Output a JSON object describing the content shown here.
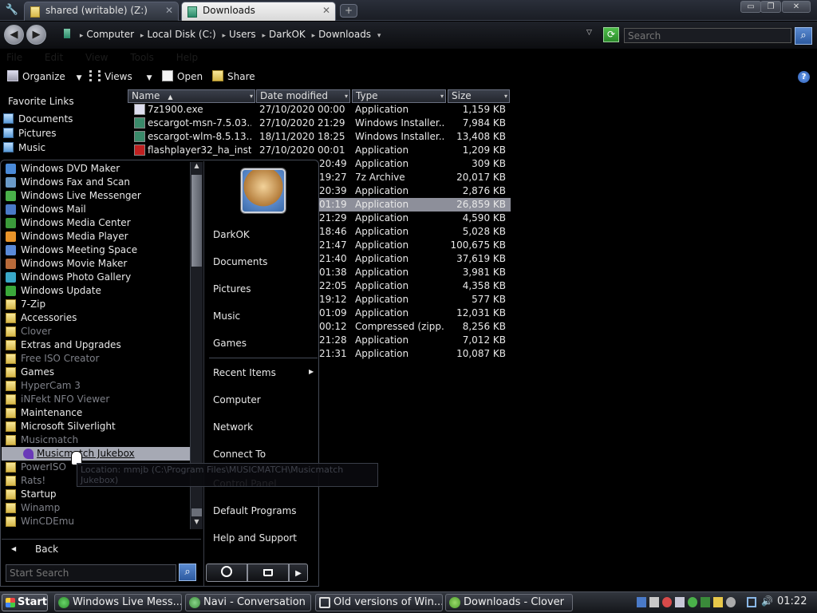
{
  "tabs": [
    {
      "label": "shared (writable) (Z:)"
    },
    {
      "label": "Downloads"
    }
  ],
  "window_controls": {
    "minimize": "▭",
    "restore": "❐",
    "close": "✕"
  },
  "address": {
    "crumbs": [
      "Computer",
      "Local Disk (C:)",
      "Users",
      "DarkOK",
      "Downloads"
    ],
    "search_placeholder": "Search"
  },
  "menubar": [
    "File",
    "Edit",
    "View",
    "Tools",
    "Help"
  ],
  "toolbar": {
    "organize": "Organize",
    "views": "Views",
    "open": "Open",
    "share": "Share",
    "help": "?"
  },
  "favorites": {
    "title": "Favorite Links",
    "items": [
      "Documents",
      "Pictures",
      "Music"
    ]
  },
  "columns": {
    "name": "Name",
    "date": "Date modified",
    "type": "Type",
    "size": "Size"
  },
  "files": [
    {
      "name": "7z1900.exe",
      "date": "27/10/2020 00:00",
      "type": "Application",
      "size": "1,159 KB"
    },
    {
      "name": "escargot-msn-7.5.03...",
      "date": "27/10/2020 21:29",
      "type": "Windows Installer...",
      "size": "7,984 KB"
    },
    {
      "name": "escargot-wlm-8.5.13...",
      "date": "18/11/2020 18:25",
      "type": "Windows Installer...",
      "size": "13,408 KB"
    },
    {
      "name": "flashplayer32_ha_insta...",
      "date": "27/10/2020 00:01",
      "type": "Application",
      "size": "1,209 KB"
    },
    {
      "name": "",
      "date": "20:49",
      "type": "Application",
      "size": "309 KB"
    },
    {
      "name": "",
      "date": "19:27",
      "type": "7z Archive",
      "size": "20,017 KB"
    },
    {
      "name": "",
      "date": "20:39",
      "type": "Application",
      "size": "2,876 KB"
    },
    {
      "name": "",
      "date": "01:19",
      "type": "Application",
      "size": "26,859 KB"
    },
    {
      "name": "",
      "date": "21:29",
      "type": "Application",
      "size": "4,590 KB"
    },
    {
      "name": "",
      "date": "18:46",
      "type": "Application",
      "size": "5,028 KB"
    },
    {
      "name": "",
      "date": "21:47",
      "type": "Application",
      "size": "100,675 KB"
    },
    {
      "name": "",
      "date": "21:40",
      "type": "Application",
      "size": "37,619 KB"
    },
    {
      "name": "",
      "date": "01:38",
      "type": "Application",
      "size": "3,981 KB"
    },
    {
      "name": "",
      "date": "22:05",
      "type": "Application",
      "size": "4,358 KB"
    },
    {
      "name": "",
      "date": "19:12",
      "type": "Application",
      "size": "577 KB"
    },
    {
      "name": "",
      "date": "01:09",
      "type": "Application",
      "size": "12,031 KB"
    },
    {
      "name": "",
      "date": "00:12",
      "type": "Compressed (zipp...",
      "size": "8,256 KB"
    },
    {
      "name": "",
      "date": "21:28",
      "type": "Application",
      "size": "7,012 KB"
    },
    {
      "name": "",
      "date": "21:31",
      "type": "Application",
      "size": "10,087 KB"
    }
  ],
  "programs": [
    {
      "label": "Windows DVD Maker",
      "kind": "app",
      "color": "#4a8ad8"
    },
    {
      "label": "Windows Fax and Scan",
      "kind": "app",
      "color": "#6a9ac8"
    },
    {
      "label": "Windows Live Messenger",
      "kind": "app",
      "color": "#4ab04a"
    },
    {
      "label": "Windows Mail",
      "kind": "app",
      "color": "#4a7ac8"
    },
    {
      "label": "Windows Media Center",
      "kind": "app",
      "color": "#3a9a3a"
    },
    {
      "label": "Windows Media Player",
      "kind": "app",
      "color": "#e8942a"
    },
    {
      "label": "Windows Meeting Space",
      "kind": "app",
      "color": "#5a8ad8"
    },
    {
      "label": "Windows Movie Maker",
      "kind": "app",
      "color": "#b86a3a"
    },
    {
      "label": "Windows Photo Gallery",
      "kind": "app",
      "color": "#3aa8c8"
    },
    {
      "label": "Windows Update",
      "kind": "app",
      "color": "#3aa83a"
    },
    {
      "label": "7-Zip",
      "kind": "folder"
    },
    {
      "label": "Accessories",
      "kind": "folder"
    },
    {
      "label": "Clover",
      "kind": "folder",
      "dim": true
    },
    {
      "label": "Extras and Upgrades",
      "kind": "folder"
    },
    {
      "label": "Free ISO Creator",
      "kind": "folder",
      "dim": true
    },
    {
      "label": "Games",
      "kind": "folder"
    },
    {
      "label": "HyperCam 3",
      "kind": "folder",
      "dim": true
    },
    {
      "label": "iNFekt NFO Viewer",
      "kind": "folder",
      "dim": true
    },
    {
      "label": "Maintenance",
      "kind": "folder"
    },
    {
      "label": "Microsoft Silverlight",
      "kind": "folder"
    },
    {
      "label": "Musicmatch",
      "kind": "folder",
      "dim": true
    },
    {
      "label": "Musicmatch Jukebox",
      "kind": "sub",
      "highlight": true
    },
    {
      "label": "PowerISO",
      "kind": "folder",
      "dim": true
    },
    {
      "label": "Rats!",
      "kind": "folder",
      "dim": true
    },
    {
      "label": "Startup",
      "kind": "folder"
    },
    {
      "label": "Winamp",
      "kind": "folder",
      "dim": true
    },
    {
      "label": "WinCDEmu",
      "kind": "folder",
      "dim": true
    }
  ],
  "back_label": "Back",
  "start_search_placeholder": "Start Search",
  "right_pane": {
    "user": "DarkOK",
    "items1": [
      "Documents",
      "Pictures",
      "Music",
      "Games"
    ],
    "items2": [
      "Recent Items",
      "Computer",
      "Network",
      "Connect To",
      "Control Panel",
      "Default Programs",
      "Help and Support"
    ]
  },
  "tooltip": "Location: mmjb (C:\\Program Files\\MUSICMATCH\\Musicmatch Jukebox)",
  "taskbar": {
    "start": "Start",
    "buttons": [
      "Windows Live Mess...",
      "Navi - Conversation",
      "Old versions of Win...",
      "Downloads - Clover"
    ],
    "clock": "01:22"
  }
}
